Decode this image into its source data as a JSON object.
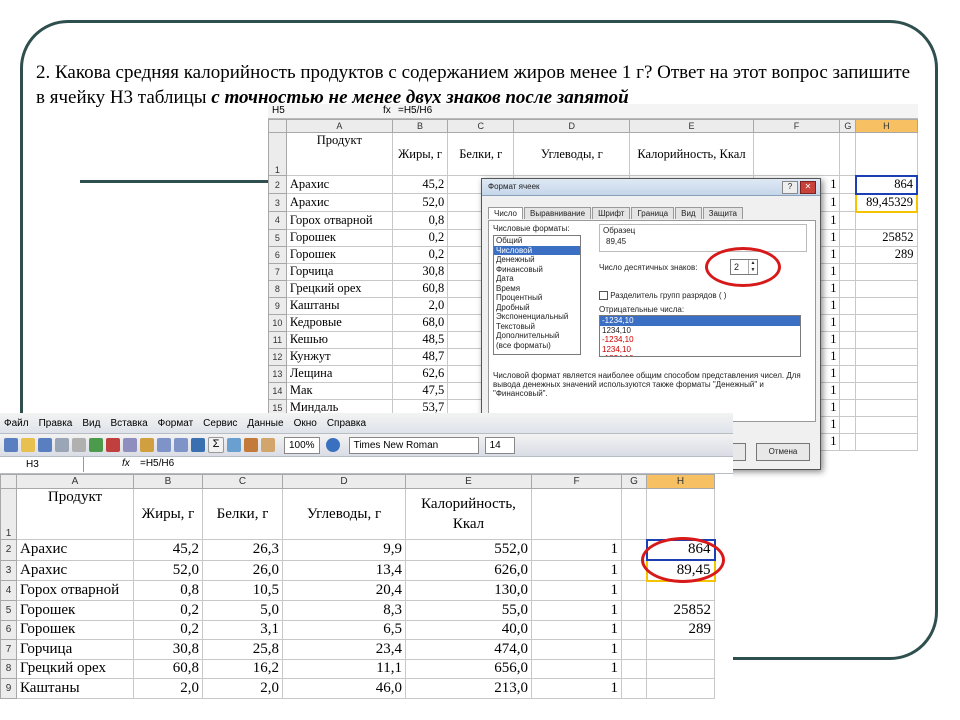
{
  "question": {
    "text_plain": "2. Какова средняя калорийность продуктов с содержанием жиров менее 1 г? Ответ на этот вопрос запишите в ячейку H3 таблицы ",
    "text_emph": "с точностью не менее двух знаков после запятой"
  },
  "back_sheet": {
    "name_box": "H5",
    "formula": "=H5/H6",
    "columns": [
      "A",
      "B",
      "C",
      "D",
      "E",
      "F",
      "G",
      "H"
    ],
    "headers": {
      "product": "Продукт",
      "fat": "Жиры, г",
      "protein": "Белки, г",
      "carbs": "Углеводы, г",
      "cal": "Калорийность, Ккал"
    },
    "rows": [
      {
        "n": "2",
        "product": "Арахис",
        "fat": "45,2",
        "f": "1",
        "h": "864"
      },
      {
        "n": "3",
        "product": "Арахис",
        "fat": "52,0",
        "f": "1",
        "h": "89,45329"
      },
      {
        "n": "4",
        "product": "Горох отварной",
        "fat": "0,8",
        "f": "1",
        "h": ""
      },
      {
        "n": "5",
        "product": "Горошек",
        "fat": "0,2",
        "f": "1",
        "h": "25852"
      },
      {
        "n": "6",
        "product": "Горошек",
        "fat": "0,2",
        "f": "1",
        "h": "289"
      },
      {
        "n": "7",
        "product": "Горчица",
        "fat": "30,8",
        "f": "1",
        "h": ""
      },
      {
        "n": "8",
        "product": "Грецкий орех",
        "fat": "60,8",
        "f": "1",
        "h": ""
      },
      {
        "n": "9",
        "product": "Каштаны",
        "fat": "2,0",
        "f": "1",
        "h": ""
      },
      {
        "n": "10",
        "product": "Кедровые",
        "fat": "68,0",
        "f": "1",
        "h": ""
      },
      {
        "n": "11",
        "product": "Кешью",
        "fat": "48,5",
        "f": "1",
        "h": ""
      },
      {
        "n": "12",
        "product": "Кунжут",
        "fat": "48,7",
        "f": "1",
        "h": ""
      },
      {
        "n": "13",
        "product": "Лещина",
        "fat": "62,6",
        "f": "1",
        "h": ""
      },
      {
        "n": "14",
        "product": "Мак",
        "fat": "47,5",
        "f": "1",
        "h": ""
      },
      {
        "n": "15",
        "product": "Миндаль",
        "fat": "53,7",
        "f": "1",
        "h": ""
      }
    ],
    "extra_rows": [
      {
        "n": "16",
        "e": ",0",
        "f": "1"
      },
      {
        "n": "17",
        "e": ",0",
        "f": "1"
      }
    ]
  },
  "dialog": {
    "title": "Формат ячеек",
    "tabs": [
      "Число",
      "Выравнивание",
      "Шрифт",
      "Граница",
      "Вид",
      "Защита"
    ],
    "formats_label": "Числовые форматы:",
    "formats": [
      "Общий",
      "Числовой",
      "Денежный",
      "Финансовый",
      "Дата",
      "Время",
      "Процентный",
      "Дробный",
      "Экспоненциальный",
      "Текстовый",
      "Дополнительный",
      "(все форматы)"
    ],
    "sample_label": "Образец",
    "sample_value": "89,45",
    "decimals_label": "Число десятичных знаков:",
    "decimals_value": "2",
    "separator_label": "Разделитель групп разрядов ( )",
    "negative_label": "Отрицательные числа:",
    "negatives": [
      "-1234,10",
      "1234,10",
      "-1234,10",
      "1234,10",
      "-1234,10"
    ],
    "description": "Числовой формат является наиболее общим способом представления чисел. Для вывода денежных значений используются также форматы \"Денежный\" и \"Финансовый\".",
    "ok_label": "ОК",
    "cancel_label": "Отмена"
  },
  "front_sheet": {
    "menu": [
      "Файл",
      "Правка",
      "Вид",
      "Вставка",
      "Формат",
      "Сервис",
      "Данные",
      "Окно",
      "Справка"
    ],
    "zoom": "100%",
    "font_name": "Times New Roman",
    "font_size": "14",
    "name_box": "H3",
    "formula": "=H5/H6",
    "columns": [
      "A",
      "B",
      "C",
      "D",
      "E",
      "F",
      "G",
      "H"
    ],
    "headers": {
      "product": "Продукт",
      "fat": "Жиры, г",
      "protein": "Белки, г",
      "carbs": "Углеводы, г",
      "cal": "Калорийность, Ккал"
    },
    "rows": [
      {
        "n": "2",
        "product": "Арахис",
        "fat": "45,2",
        "protein": "26,3",
        "carbs": "9,9",
        "cal": "552,0",
        "f": "1",
        "h": "864"
      },
      {
        "n": "3",
        "product": "Арахис",
        "fat": "52,0",
        "protein": "26,0",
        "carbs": "13,4",
        "cal": "626,0",
        "f": "1",
        "h": "89,45"
      },
      {
        "n": "4",
        "product": "Горох отварной",
        "fat": "0,8",
        "protein": "10,5",
        "carbs": "20,4",
        "cal": "130,0",
        "f": "1",
        "h": ""
      },
      {
        "n": "5",
        "product": "Горошек",
        "fat": "0,2",
        "protein": "5,0",
        "carbs": "8,3",
        "cal": "55,0",
        "f": "1",
        "h": "25852"
      },
      {
        "n": "6",
        "product": "Горошек",
        "fat": "0,2",
        "protein": "3,1",
        "carbs": "6,5",
        "cal": "40,0",
        "f": "1",
        "h": "289"
      },
      {
        "n": "7",
        "product": "Горчица",
        "fat": "30,8",
        "protein": "25,8",
        "carbs": "23,4",
        "cal": "474,0",
        "f": "1",
        "h": ""
      },
      {
        "n": "8",
        "product": "Грецкий орех",
        "fat": "60,8",
        "protein": "16,2",
        "carbs": "11,1",
        "cal": "656,0",
        "f": "1",
        "h": ""
      },
      {
        "n": "9",
        "product": "Каштаны",
        "fat": "2,0",
        "protein": "2,0",
        "carbs": "46,0",
        "cal": "213,0",
        "f": "1",
        "h": ""
      }
    ]
  }
}
